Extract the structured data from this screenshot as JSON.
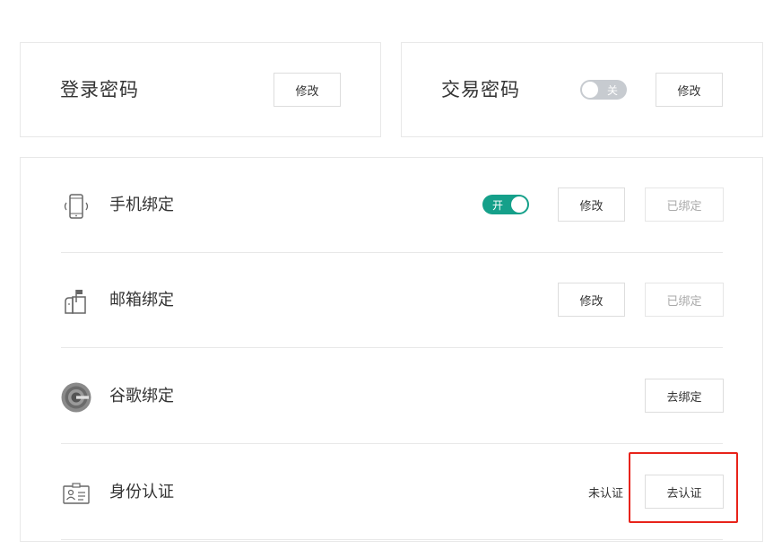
{
  "login_password": {
    "title": "登录密码",
    "modify_label": "修改"
  },
  "trade_password": {
    "title": "交易密码",
    "toggle_label": "关",
    "toggle_state": "off",
    "modify_label": "修改"
  },
  "bindings": [
    {
      "label": "手机绑定",
      "icon": "phone-icon",
      "toggle_label": "开",
      "toggle_state": "on",
      "modify_label": "修改",
      "bound_label": "已绑定"
    },
    {
      "label": "邮箱绑定",
      "icon": "mailbox-icon",
      "modify_label": "修改",
      "bound_label": "已绑定"
    },
    {
      "label": "谷歌绑定",
      "icon": "google-authenticator-icon",
      "action_label": "去绑定"
    },
    {
      "label": "身份认证",
      "icon": "id-card-icon",
      "status_label": "未认证",
      "action_label": "去认证"
    }
  ],
  "colors": {
    "accent_green": "#15a08a",
    "toggle_off": "#c7cbd0",
    "highlight_red": "#e8231a",
    "border": "#e8e8e8"
  }
}
